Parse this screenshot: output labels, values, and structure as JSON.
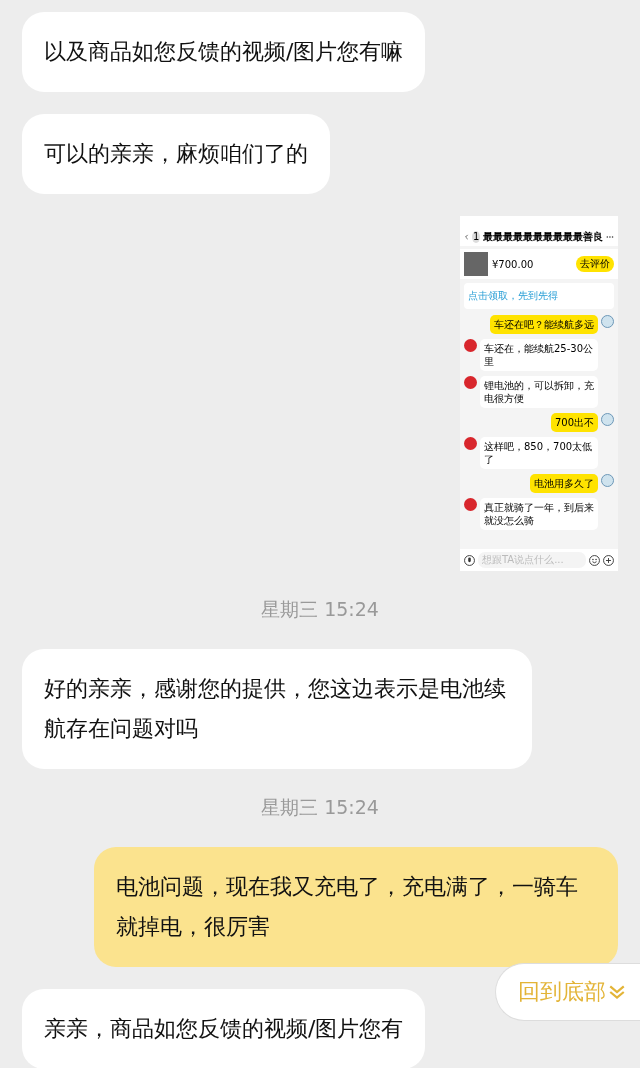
{
  "messages": [
    {
      "kind": "text",
      "outgoing": false,
      "text": "以及商品如您反馈的视频/图片您有嘛"
    },
    {
      "kind": "text",
      "outgoing": false,
      "text": "可以的亲亲，麻烦咱们了的"
    },
    {
      "kind": "image",
      "outgoing": true,
      "screenshot": {
        "title": "最最最最最最最最最最善良",
        "badge": "1",
        "product": {
          "price": "¥700.00",
          "button": "去评价"
        },
        "banner": "点击领取，先到先得",
        "chat": [
          {
            "outgoing": true,
            "text": "车还在吧？能续航多远"
          },
          {
            "outgoing": false,
            "text": "车还在，能续航25-30公里"
          },
          {
            "outgoing": false,
            "text": "锂电池的，可以拆卸，充电很方便"
          },
          {
            "outgoing": true,
            "text": "700出不"
          },
          {
            "outgoing": false,
            "text": "这样吧，850，700太低了"
          },
          {
            "outgoing": true,
            "text": "电池用多久了"
          },
          {
            "outgoing": false,
            "text": "真正就骑了一年，到后来就没怎么骑"
          }
        ],
        "input": {
          "placeholder": "想跟TA说点什么..."
        }
      }
    },
    {
      "kind": "time",
      "text": "星期三 15:24"
    },
    {
      "kind": "text",
      "outgoing": false,
      "text": "好的亲亲，感谢您的提供，您这边表示是电池续航存在问题对吗"
    },
    {
      "kind": "time",
      "text": "星期三 15:24"
    },
    {
      "kind": "text",
      "outgoing": true,
      "text": "电池问题，现在我又充电了，充电满了，一骑车就掉电，很厉害"
    },
    {
      "kind": "text",
      "outgoing": false,
      "text": "亲亲，商品如您反馈的视频/图片您有"
    }
  ],
  "back_to_bottom": {
    "label": "回到底部"
  }
}
